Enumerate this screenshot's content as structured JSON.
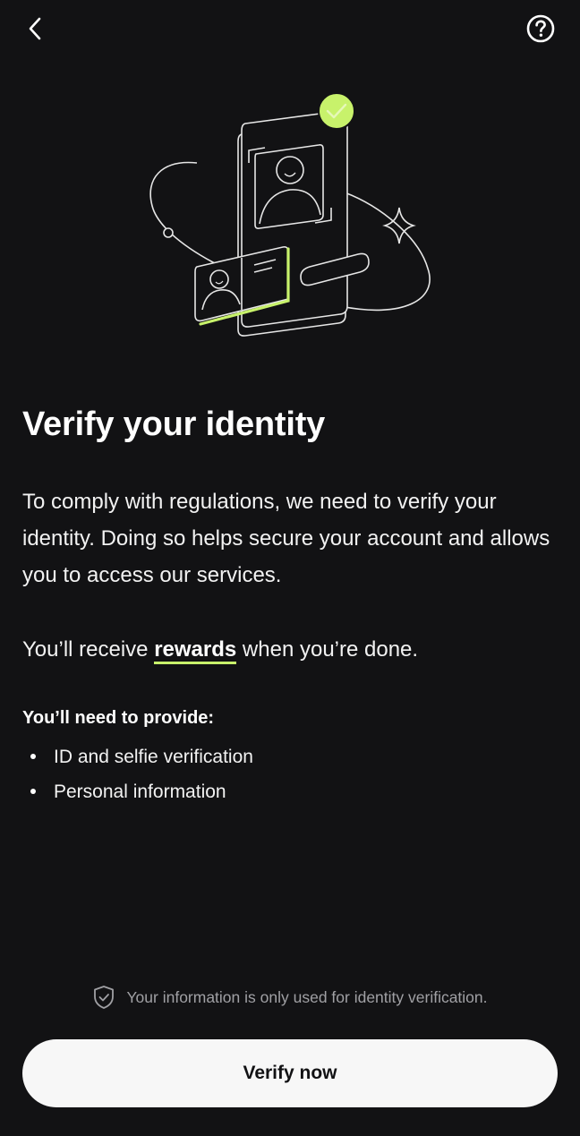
{
  "header": {
    "back_icon": "chevron-left-icon",
    "help_icon": "question-circle-icon"
  },
  "illustration": {
    "name": "identity-verification-illustration",
    "accent_color": "#c8f26b",
    "line_color": "#e6e6e6"
  },
  "main": {
    "title": "Verify your identity",
    "description": "To comply with regulations, we need to verify your identity. Doing so helps secure your account and allows you to access our services.",
    "rewards_prefix": "You’ll receive ",
    "rewards_link": "rewards",
    "rewards_suffix": " when you’re done.",
    "requirements_title": "You’ll need to provide:",
    "requirements": [
      "ID and selfie verification",
      "Personal information"
    ]
  },
  "footer": {
    "privacy_icon": "shield-check-icon",
    "privacy_text": "Your information is only used for identity verification.",
    "verify_button_label": "Verify now"
  },
  "colors": {
    "background": "#121214",
    "accent": "#c8f26b",
    "button_bg": "#f7f7f7",
    "muted_text": "#a0a0a4"
  }
}
